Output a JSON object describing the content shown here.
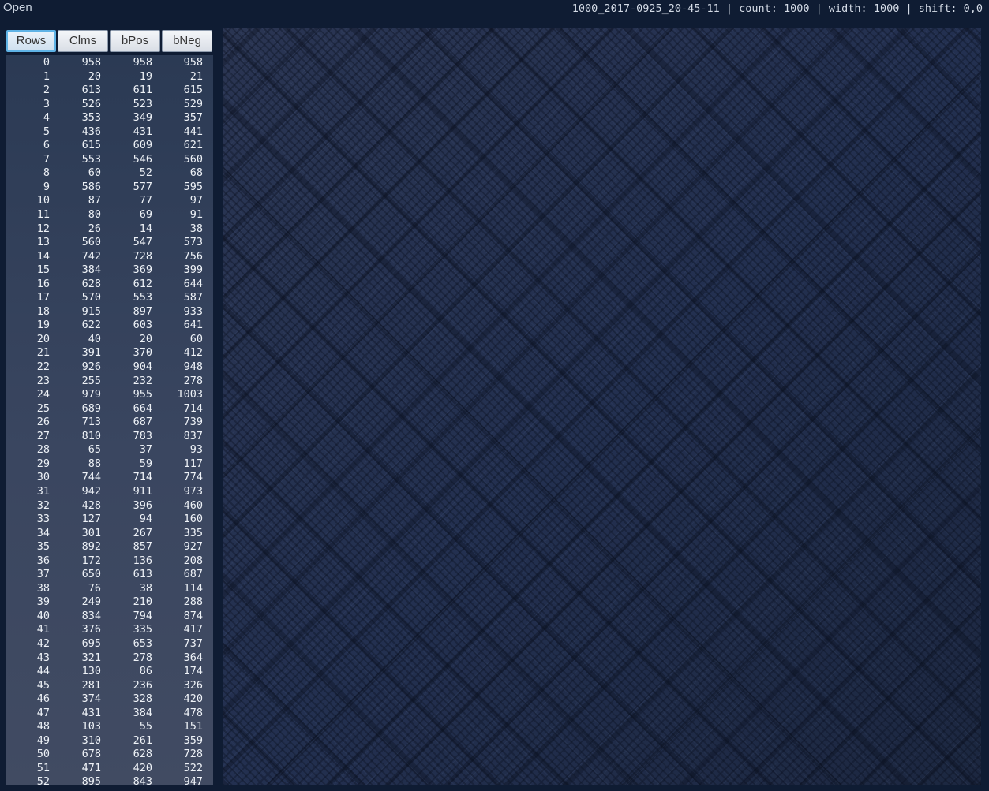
{
  "toolbar": {
    "open_label": "Open"
  },
  "status": {
    "filename": "1000_2017-0925_20-45-11",
    "count_text": "count: 1000",
    "width_text": "width: 1000",
    "shift_text": "shift: 0,0",
    "separator": " | "
  },
  "tabs": [
    {
      "label": "Rows",
      "active": true
    },
    {
      "label": "Clms",
      "active": false
    },
    {
      "label": "bPos",
      "active": false
    },
    {
      "label": "bNeg",
      "active": false
    }
  ],
  "table": {
    "rows": [
      [
        0,
        958,
        958,
        958
      ],
      [
        1,
        20,
        19,
        21
      ],
      [
        2,
        613,
        611,
        615
      ],
      [
        3,
        526,
        523,
        529
      ],
      [
        4,
        353,
        349,
        357
      ],
      [
        5,
        436,
        431,
        441
      ],
      [
        6,
        615,
        609,
        621
      ],
      [
        7,
        553,
        546,
        560
      ],
      [
        8,
        60,
        52,
        68
      ],
      [
        9,
        586,
        577,
        595
      ],
      [
        10,
        87,
        77,
        97
      ],
      [
        11,
        80,
        69,
        91
      ],
      [
        12,
        26,
        14,
        38
      ],
      [
        13,
        560,
        547,
        573
      ],
      [
        14,
        742,
        728,
        756
      ],
      [
        15,
        384,
        369,
        399
      ],
      [
        16,
        628,
        612,
        644
      ],
      [
        17,
        570,
        553,
        587
      ],
      [
        18,
        915,
        897,
        933
      ],
      [
        19,
        622,
        603,
        641
      ],
      [
        20,
        40,
        20,
        60
      ],
      [
        21,
        391,
        370,
        412
      ],
      [
        22,
        926,
        904,
        948
      ],
      [
        23,
        255,
        232,
        278
      ],
      [
        24,
        979,
        955,
        1003
      ],
      [
        25,
        689,
        664,
        714
      ],
      [
        26,
        713,
        687,
        739
      ],
      [
        27,
        810,
        783,
        837
      ],
      [
        28,
        65,
        37,
        93
      ],
      [
        29,
        88,
        59,
        117
      ],
      [
        30,
        744,
        714,
        774
      ],
      [
        31,
        942,
        911,
        973
      ],
      [
        32,
        428,
        396,
        460
      ],
      [
        33,
        127,
        94,
        160
      ],
      [
        34,
        301,
        267,
        335
      ],
      [
        35,
        892,
        857,
        927
      ],
      [
        36,
        172,
        136,
        208
      ],
      [
        37,
        650,
        613,
        687
      ],
      [
        38,
        76,
        38,
        114
      ],
      [
        39,
        249,
        210,
        288
      ],
      [
        40,
        834,
        794,
        874
      ],
      [
        41,
        376,
        335,
        417
      ],
      [
        42,
        695,
        653,
        737
      ],
      [
        43,
        321,
        278,
        364
      ],
      [
        44,
        130,
        86,
        174
      ],
      [
        45,
        281,
        236,
        326
      ],
      [
        46,
        374,
        328,
        420
      ],
      [
        47,
        431,
        384,
        478
      ],
      [
        48,
        103,
        55,
        151
      ],
      [
        49,
        310,
        261,
        359
      ],
      [
        50,
        678,
        628,
        728
      ],
      [
        51,
        471,
        420,
        522
      ],
      [
        52,
        895,
        843,
        947
      ]
    ]
  }
}
